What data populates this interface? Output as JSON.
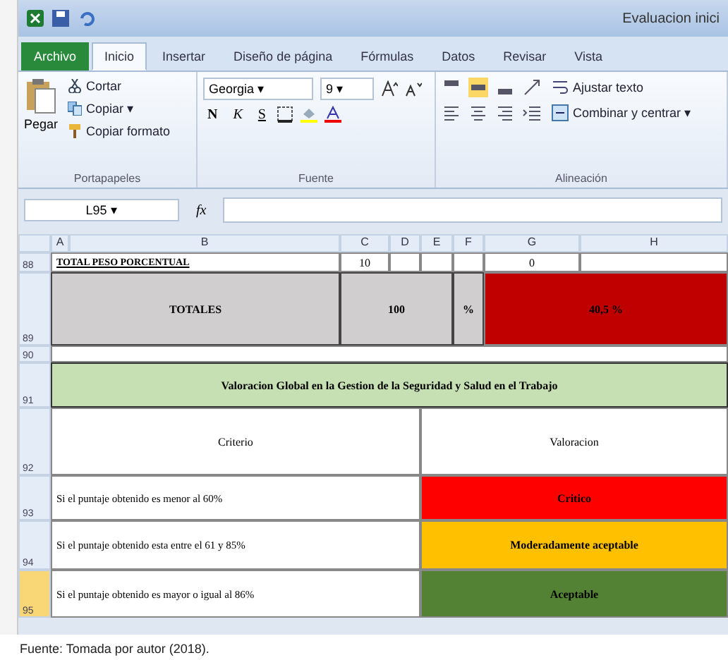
{
  "window": {
    "title": "Evaluacion inici"
  },
  "tabs": [
    {
      "label": "Archivo",
      "kind": "file",
      "selected": false
    },
    {
      "label": "Inicio",
      "kind": "tab",
      "selected": true
    },
    {
      "label": "Insertar",
      "kind": "tab",
      "selected": false
    },
    {
      "label": "Diseño de página",
      "kind": "tab",
      "selected": false
    },
    {
      "label": "Fórmulas",
      "kind": "tab",
      "selected": false
    },
    {
      "label": "Datos",
      "kind": "tab",
      "selected": false
    },
    {
      "label": "Revisar",
      "kind": "tab",
      "selected": false
    },
    {
      "label": "Vista",
      "kind": "tab",
      "selected": false
    }
  ],
  "clipboard": {
    "paste": "Pegar",
    "cut": "Cortar",
    "copy": "Copiar ▾",
    "format_painter": "Copiar formato",
    "group": "Portapapeles"
  },
  "font": {
    "name": "Georgia ▾",
    "size": "9 ▾",
    "bold": "N",
    "italic": "K",
    "underline": "S",
    "group": "Fuente"
  },
  "alignment": {
    "wrap": "Ajustar texto",
    "merge": "Combinar y centrar ▾",
    "group": "Alineación"
  },
  "formula_bar": {
    "name_box": "L95 ▾",
    "fx": "fx"
  },
  "columns": [
    "A",
    "B",
    "C",
    "D",
    "E",
    "F",
    "G",
    "H"
  ],
  "row_headers": [
    {
      "label": "88",
      "selected": false
    },
    {
      "label": "89",
      "selected": false
    },
    {
      "label": "90",
      "selected": false
    },
    {
      "label": "91",
      "selected": false
    },
    {
      "label": "92",
      "selected": false
    },
    {
      "label": "93",
      "selected": false
    },
    {
      "label": "94",
      "selected": false
    },
    {
      "label": "95",
      "selected": true
    }
  ],
  "total_weight": {
    "label": "TOTAL PESO PORCENTUAL",
    "c": "10",
    "g": "0"
  },
  "totals": {
    "label": "TOTALES",
    "value": "100",
    "unit": "%",
    "result": "40,5 %",
    "color": "#c00000"
  },
  "global_title": "Valoracion Global en la Gestion de la Seguridad y Salud en el Trabajo",
  "criteria_header": {
    "criterion": "Criterio",
    "rating": "Valoracion"
  },
  "criteria": [
    {
      "criterion": "Si el puntaje obtenido es menor al 60%",
      "rating": "Critico",
      "color": "#ff0000"
    },
    {
      "criterion": "Si el puntaje obtenido esta entre el 61 y 85%",
      "rating": "Moderadamente aceptable",
      "color": "#ffc000"
    },
    {
      "criterion": "Si el puntaje obtenido es mayor o igual al 86%",
      "rating": "Aceptable",
      "color": "#548235"
    }
  ],
  "caption": "Fuente: Tomada por autor (2018)."
}
